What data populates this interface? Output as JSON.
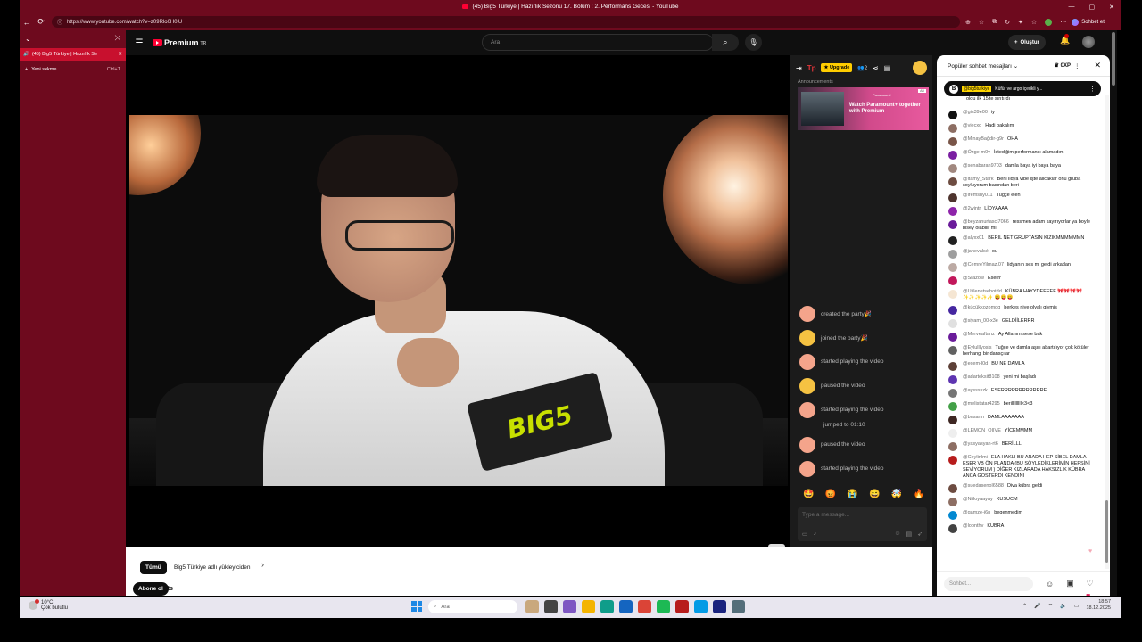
{
  "browser": {
    "window_title": "(45) Big5 Türkiye | Hazırlık Sezonu 17. Bölüm : 2. Performans Gecesi - YouTube",
    "url": "https://www.youtube.com/watch?v=z09Rlo0H0lU",
    "chat_button": "Sohbet et"
  },
  "sidebar": {
    "active_tab": "(45) Big5 Türkiye | Hazırlık Se",
    "new_tab": "Yeni sekme",
    "new_tab_shortcut": "Ctrl+T"
  },
  "youtube": {
    "logo": "Premium",
    "logo_region": "TR",
    "search_placeholder": "Ara",
    "create_label": "Oluştur"
  },
  "video": {
    "tablet_text": "BIG5"
  },
  "teleparty": {
    "logo": "Tp",
    "upgrade": "Upgrade",
    "viewer_count": "2",
    "announcements_label": "Announcements",
    "ad_text": "Watch Paramount+ together with Premium",
    "ad_brand": "Paramount+",
    "ad_badge": "AD",
    "events": [
      {
        "text": "created the party🎉",
        "avatar": "peach"
      },
      {
        "text": "joined the party🎉",
        "avatar": "yellow"
      },
      {
        "text": "started playing the video",
        "avatar": "peach"
      },
      {
        "text": "paused the video",
        "avatar": "yellow"
      },
      {
        "text": "started playing the video",
        "avatar": "peach"
      }
    ],
    "jump_text": "jumped to 01:10",
    "events_after": [
      {
        "text": "paused the video",
        "avatar": "peach"
      },
      {
        "text": "started playing the video",
        "avatar": "peach"
      }
    ],
    "emojis": [
      "🤩",
      "😡",
      "😭",
      "😄",
      "🤯",
      "🔥"
    ],
    "input_placeholder": "Type a message..."
  },
  "below": {
    "chip_all": "Tümü",
    "chip_2": "Big5 Türkiye adlı yükleyiciden",
    "subscribe": "Abone ol",
    "subscribe_rest": "rts"
  },
  "chat": {
    "title": "Popüler sohbet mesajları",
    "xp": "0XP",
    "pinned_author": "@big5turkiye",
    "pinned_text": "Küfür ve argo içerikli y...",
    "input_placeholder": "Sohbet...",
    "messages": [
      {
        "author": "",
        "text": "oldu ilk 15'te sırıtırdı",
        "color": "#ffffff"
      },
      {
        "author": "@gis39e00",
        "text": "iy",
        "color": "#111111"
      },
      {
        "author": "@viecxq",
        "text": "Hadi bakalım",
        "color": "#8d6e63"
      },
      {
        "author": "@MinayBağdir-g9r",
        "text": "OHA",
        "color": "#795548"
      },
      {
        "author": "@Özge-m0v",
        "text": "İstediğim performansı alamadım",
        "color": "#7b1fa2"
      },
      {
        "author": "@senabaran9703",
        "text": "damla baya iyi baya baya",
        "color": "#a1887f"
      },
      {
        "author": "@itamy_Stark",
        "text": "Benl lidya vibe işte alicaklar onu gruba soyluyorum basından beri",
        "color": "#6d4c41"
      },
      {
        "author": "@iremsny011",
        "text": "Tuğçe elen",
        "color": "#4e342e"
      },
      {
        "author": "@2wintr",
        "text": "LİDYAAAA",
        "color": "#8e24aa"
      },
      {
        "author": "@beyzanurtasci7066",
        "text": "ressmen adam kayırıyorlar ya boyle bisey olabilir mi",
        "color": "#6a1b9a"
      },
      {
        "author": "@alyxx01",
        "text": "BERİL NET GRUPTASIN KIZIKMMMMMMN",
        "color": "#212121"
      },
      {
        "author": "@janevalsé",
        "text": "ou",
        "color": "#9e9e9e"
      },
      {
        "author": "@CemreYilmaz.07",
        "text": "lidyanın ses mi geldi arkadan",
        "color": "#bcaaa4"
      },
      {
        "author": "@Srazow",
        "text": "Eserrr",
        "color": "#c2185b"
      },
      {
        "author": "@Ufilenetsebotdd",
        "text": "KÜBRA HAYYDEEEEE 🎀🎀🎀🎀 ✨✨✨✨✨ 😛😛😛",
        "color": "#f5e6d3"
      },
      {
        "author": "@küçükkozomgg",
        "text": "herkes niye olyalı giymiş",
        "color": "#4527a0"
      },
      {
        "author": "@siyam_00-x3e",
        "text": "GELDİİLERRR",
        "color": "#e0e0e0"
      },
      {
        "author": "@Merveaftanz",
        "text": "Ay Allahım sese bak",
        "color": "#6a1b9a"
      },
      {
        "author": "@Eylulllyosis",
        "text": "Tuğçe ve damla aşırı abartılıyor çok kötüler herhangi bir dansçılar",
        "color": "#616161"
      },
      {
        "author": "@ecem-l0d",
        "text": "BU NE DAMLA",
        "color": "#5d4037"
      },
      {
        "author": "@adarteksit8108",
        "text": "yeni mi başladı",
        "color": "#5e35b1"
      },
      {
        "author": "@aysssszk",
        "text": "ESERRRRRRRRRRRRE",
        "color": "#757575"
      },
      {
        "author": "@melistatar4295",
        "text": "berilllllllll<3<3",
        "color": "#43a047"
      },
      {
        "author": "@bnsarın",
        "text": "DAMLAAAAAAA",
        "color": "#3e2723"
      },
      {
        "author": "@LEMON_OIIVE",
        "text": "YİCEMMMM",
        "color": "#eeeeee"
      },
      {
        "author": "@yasyasyan-rt6",
        "text": "BERİLLL",
        "color": "#8d6e63"
      },
      {
        "author": "@Ceylinlmi",
        "text": "ELA HAKLI BU ARADA HEP SİBEL DAMLA ESER VB ÖN PLANDA (BU SÖYLEDİKLERİMİN HEPSİNİ SEVİYORUM ) DİĞER KIZLARADA HAKSIZLIK KÜBRA ANCA GÖSTERDİ KENDİNİ",
        "color": "#b71c1c"
      },
      {
        "author": "@suedasenol6588",
        "text": "Diva kübra geldi",
        "color": "#6d4c41"
      },
      {
        "author": "@Niiloyaayay",
        "text": "KUSUCM",
        "color": "#8d6e63"
      },
      {
        "author": "@gamze-j6n",
        "text": "begenmedim",
        "color": "#0288d1"
      },
      {
        "author": "@loonthv",
        "text": "KÜBRA",
        "color": "#424242"
      }
    ]
  },
  "taskbar": {
    "temperature": "10°C",
    "weather": "Çok bulutlu",
    "search": "Ara",
    "time": "18:57",
    "date": "18.12.2025"
  }
}
